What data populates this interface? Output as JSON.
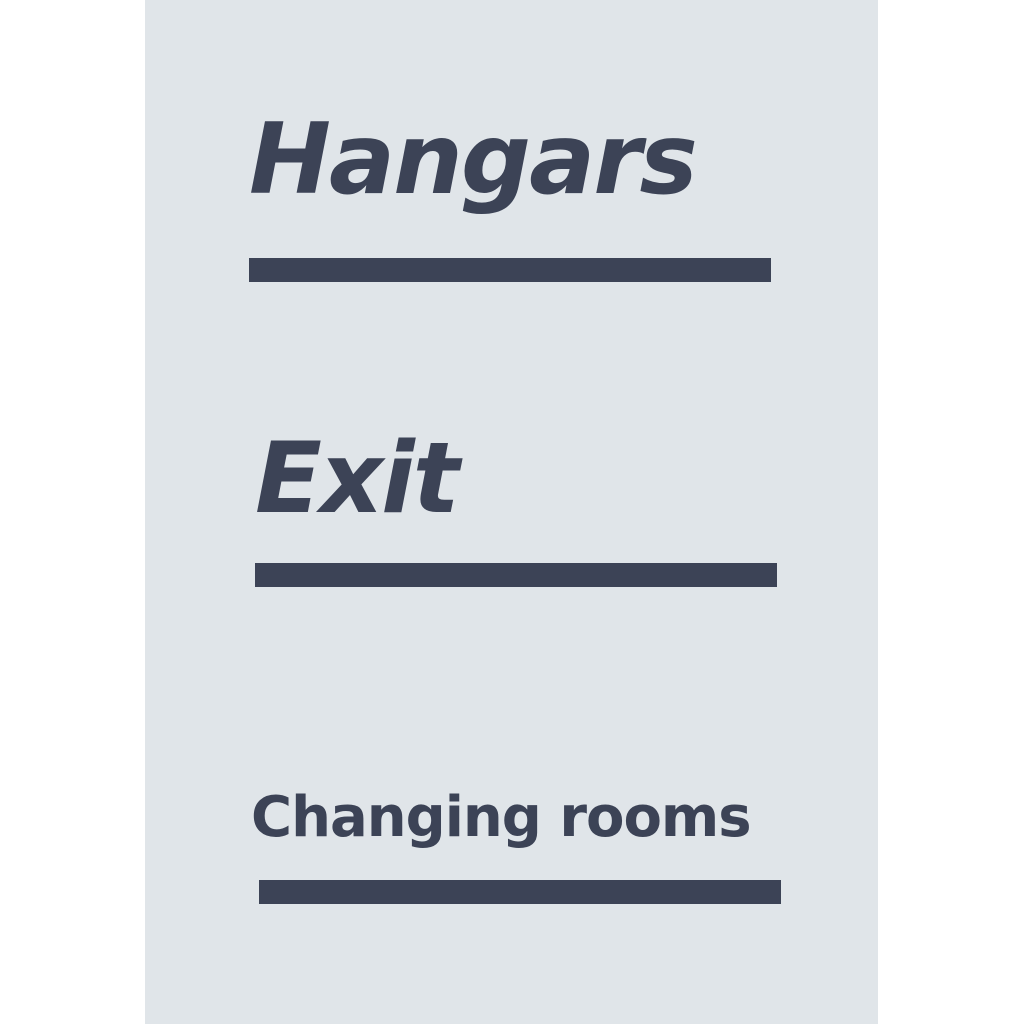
{
  "sign": {
    "entries": [
      {
        "label": "Hangars"
      },
      {
        "label": "Exit"
      },
      {
        "label": "Changing rooms"
      }
    ],
    "colors": {
      "panel": "#e0e5e9",
      "text": "#3c4356",
      "rule": "#3c4356"
    }
  }
}
